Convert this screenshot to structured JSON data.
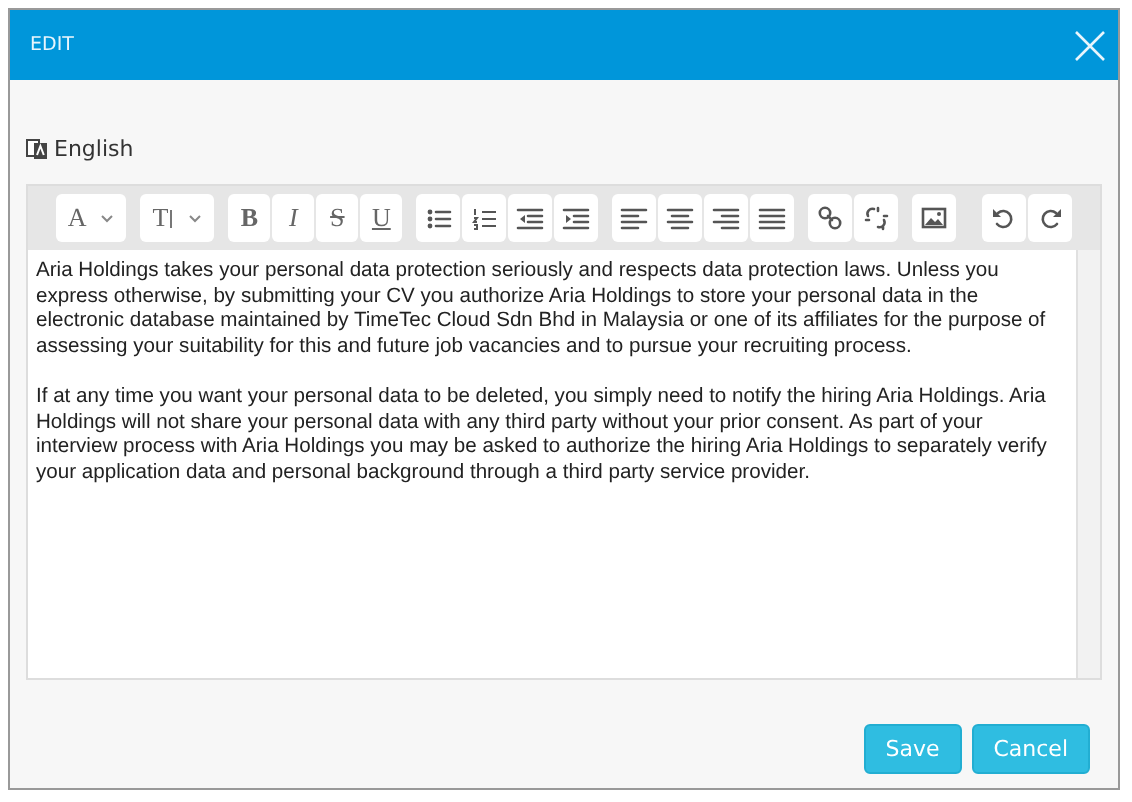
{
  "window": {
    "title": "EDIT"
  },
  "language": {
    "label": "English"
  },
  "toolbar": [
    [
      {
        "kind": "font-color",
        "text": "A"
      }
    ],
    [
      {
        "kind": "font-size",
        "text": "T"
      }
    ],
    [
      {
        "kind": "bold",
        "text": "B"
      },
      {
        "kind": "italic",
        "text": "I"
      },
      {
        "kind": "strike",
        "text": "S"
      },
      {
        "kind": "underline",
        "text": "U"
      }
    ],
    [
      {
        "kind": "bullet-list"
      },
      {
        "kind": "numbered-list"
      },
      {
        "kind": "outdent"
      },
      {
        "kind": "indent"
      }
    ],
    [
      {
        "kind": "align-left"
      },
      {
        "kind": "align-center"
      },
      {
        "kind": "align-right"
      },
      {
        "kind": "align-justify"
      }
    ],
    [
      {
        "kind": "link"
      },
      {
        "kind": "unlink"
      }
    ],
    [
      {
        "kind": "image"
      }
    ],
    [
      {
        "kind": "undo"
      },
      {
        "kind": "redo"
      }
    ]
  ],
  "content": [
    "Aria Holdings takes your personal data protection seriously and respects data protection laws. Unless you express otherwise, by submitting your CV you authorize Aria Holdings to store your personal data in the electronic database maintained by TimeTec Cloud Sdn Bhd in Malaysia or one of its affiliates for the purpose of assessing your suitability for this and future job vacancies and to pursue your recruiting process.",
    "If at any time you want your personal data to be deleted, you simply need to notify the hiring Aria Holdings. Aria Holdings will not share your personal data with any third party without your prior consent. As part of your interview process with Aria Holdings you may be asked to authorize the hiring Aria Holdings to separately verify your application data and personal background through a third party service provider."
  ],
  "buttons": [
    "Save",
    "Cancel"
  ]
}
